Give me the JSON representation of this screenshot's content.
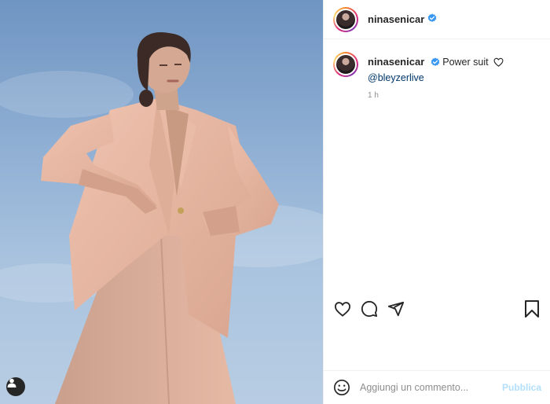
{
  "post": {
    "username": "ninasenicar",
    "verified": true,
    "caption": "Power suit",
    "caption_emoji": "heart-outline",
    "mention": "@bleyzerlive",
    "time": "1 h"
  },
  "comment_box": {
    "placeholder": "Aggiungi un commento...",
    "publish_label": "Pubblica"
  },
  "icons": {
    "like": "heart-icon",
    "comment": "comment-icon",
    "share": "share-icon",
    "save": "bookmark-icon",
    "emoji": "emoji-icon",
    "tag": "user-tag-icon"
  },
  "colors": {
    "verified_blue": "#3897f0",
    "mention": "#00376b",
    "publish_disabled": "#b2dffc",
    "suit": "#e8b8a4"
  }
}
